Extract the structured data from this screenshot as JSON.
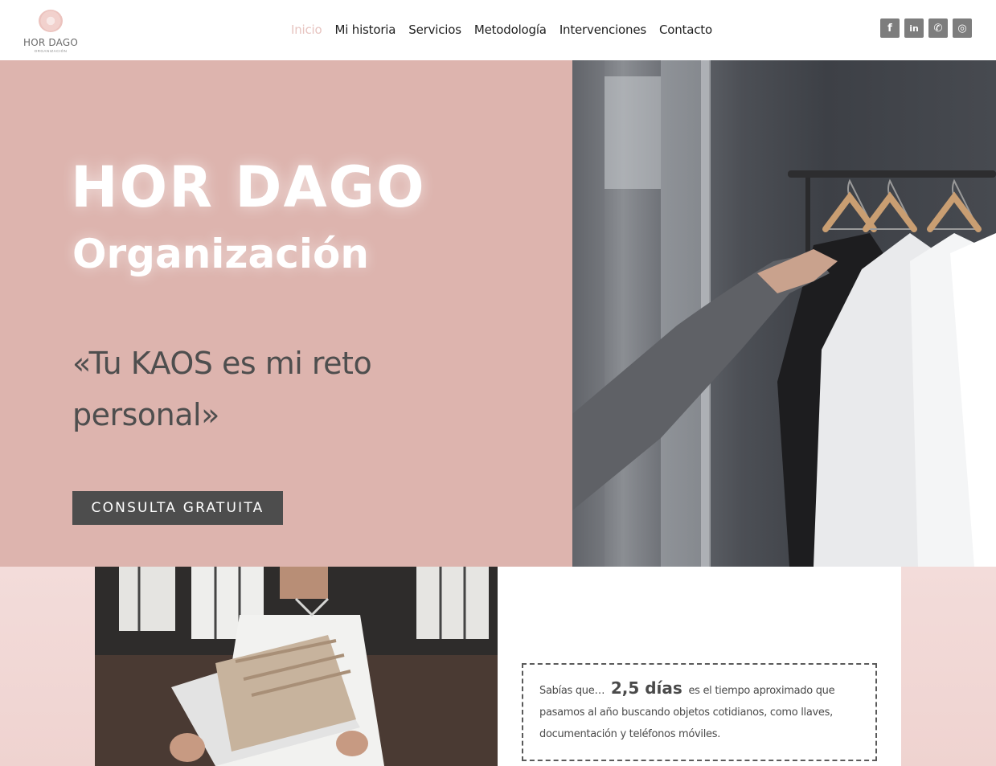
{
  "brand": {
    "name": "HOR DAGO",
    "tagline": "ORGANIZACIÓN"
  },
  "nav": {
    "items": [
      {
        "label": "Inicio",
        "active": true
      },
      {
        "label": "Mi historia"
      },
      {
        "label": "Servicios"
      },
      {
        "label": "Metodología"
      },
      {
        "label": "Intervenciones"
      },
      {
        "label": "Contacto"
      }
    ]
  },
  "social": [
    {
      "icon": "facebook-icon",
      "glyph": "f"
    },
    {
      "icon": "linkedin-icon",
      "glyph": "in"
    },
    {
      "icon": "whatsapp-icon",
      "glyph": "✆"
    },
    {
      "icon": "instagram-icon",
      "glyph": "◎"
    }
  ],
  "hero": {
    "title": "HOR DAGO",
    "subtitle": "Organización",
    "quote": "«Tu KAOS es mi reto personal»",
    "cta_label": "CONSULTA GRATUITA"
  },
  "fact": {
    "prefix": "Sabías que…",
    "highlight": "2,5  días",
    "text": "es el tiempo aproximado que pasamos al año buscando objetos cotidianos, como llaves, documentación y teléfonos móviles."
  },
  "colors": {
    "hero_bg": "#ddb4ae",
    "active_nav": "#e7c4c0",
    "cta_bg": "#4d4d4d",
    "social_bg": "#7d7d7d"
  }
}
